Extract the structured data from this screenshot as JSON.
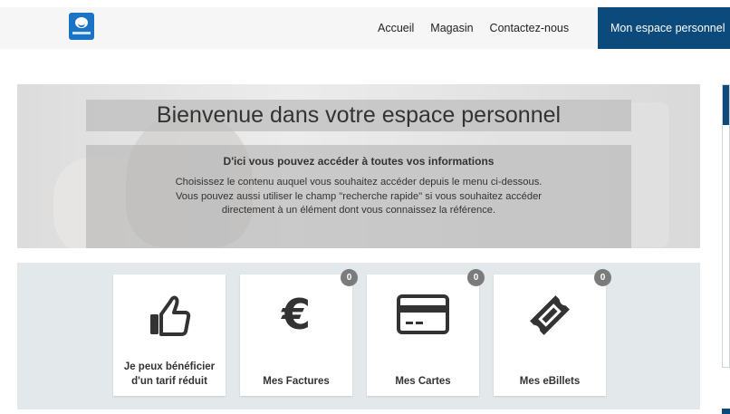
{
  "nav": {
    "items": [
      "Accueil",
      "Magasin",
      "Contactez-nous"
    ],
    "active": "Mon espace personnel"
  },
  "hero": {
    "title": "Bienvenue dans votre espace personnel",
    "subtitle": "D'ici vous pouvez accéder à toutes vos informations",
    "text": "Choisissez le contenu auquel vous souhaitez accéder depuis le menu ci-dessous. Vous pouvez aussi utiliser le champ \"recherche rapide\" si vous souhaitez accéder directement à un élément dont vous connaissez la référence."
  },
  "cards": [
    {
      "label": "Je peux bénéficier d'un tarif réduit",
      "icon": "thumbs-up-icon"
    },
    {
      "label": "Mes Factures",
      "icon": "euro-icon",
      "badge": "0"
    },
    {
      "label": "Mes Cartes",
      "icon": "credit-card-icon",
      "badge": "0"
    },
    {
      "label": "Mes eBillets",
      "icon": "ticket-icon",
      "badge": "0"
    }
  ],
  "colors": {
    "nav_active_bg": "#0b4a7a",
    "cards_area_bg": "#e3e8ea",
    "badge_bg": "#7b7b7b"
  }
}
